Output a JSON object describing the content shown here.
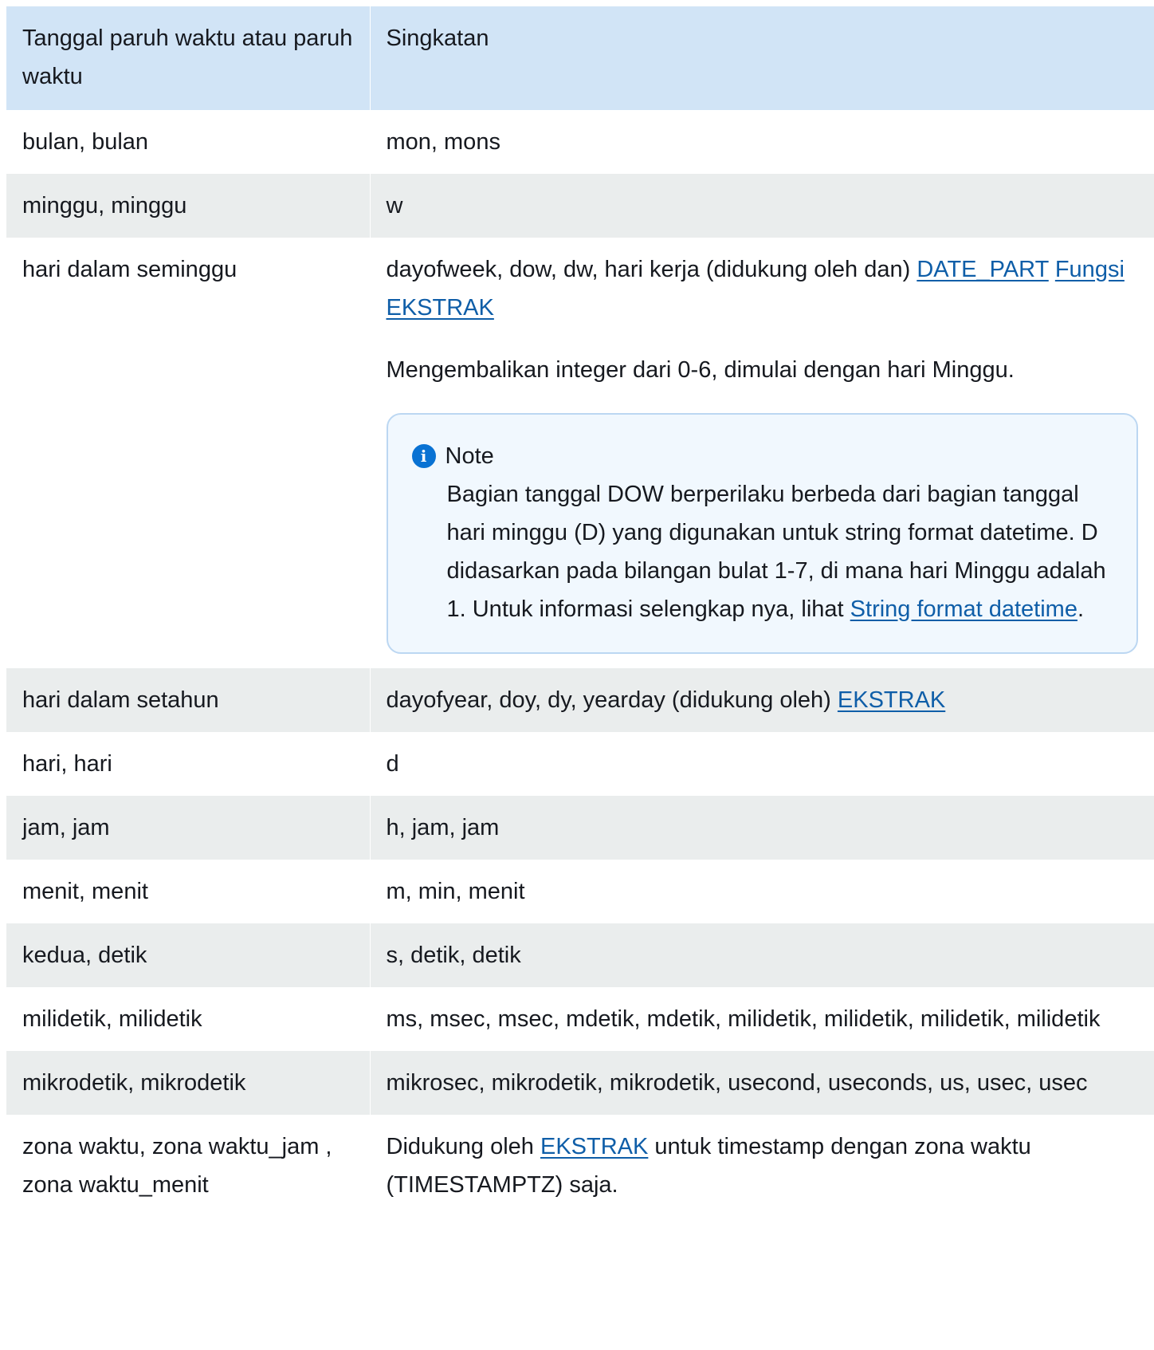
{
  "table": {
    "headers": [
      "Tanggal paruh waktu atau paruh waktu",
      "Singkatan"
    ],
    "rows": [
      {
        "part": "bulan, bulan",
        "abbr": "mon, mons"
      },
      {
        "part": "minggu, minggu",
        "abbr": "w"
      },
      {
        "part": "hari dalam seminggu",
        "abbr_text": "dayofweek, dow, dw, hari kerja (didukung oleh dan)",
        "link1": "DATE_PART",
        "link2": "Fungsi EKSTRAK",
        "extra": "Mengembalikan integer dari 0-6, dimulai dengan hari Minggu.",
        "note": {
          "title": "Note",
          "icon": "info-icon",
          "text": "Bagian tanggal DOW berperilaku berbeda dari bagian tanggal hari minggu (D) yang digunakan untuk string format datetime. D didasarkan pada bilangan bulat 1-7, di mana hari Minggu adalah 1. Untuk informasi selengkap nya, lihat",
          "link": "String format datetime",
          "after": "."
        }
      },
      {
        "part": "hari dalam setahun",
        "abbr_text": "dayofyear, doy, dy, yearday (didukung oleh)",
        "link": "EKSTRAK"
      },
      {
        "part": "hari, hari",
        "abbr": "d"
      },
      {
        "part": "jam, jam",
        "abbr": "h, jam, jam"
      },
      {
        "part": "menit, menit",
        "abbr": "m, min, menit"
      },
      {
        "part": "kedua, detik",
        "abbr": "s, detik, detik"
      },
      {
        "part": "milidetik, milidetik",
        "abbr": "ms, msec, msec, mdetik, mdetik, milidetik, milidetik, milidetik, milidetik"
      },
      {
        "part": "mikrodetik, mikrodetik",
        "abbr": "mikrosec, mikrodetik, mikrodetik, usecond, useconds, us, usec, usec"
      },
      {
        "part": "zona waktu, zona waktu_jam , zona waktu_menit",
        "abbr_before": "Didukung oleh",
        "link": "EKSTRAK",
        "abbr_after": "untuk timestamp dengan zona waktu (TIMESTAMPTZ) saja."
      }
    ]
  },
  "colors": {
    "header_bg": "#d1e4f6",
    "stripe_bg": "#eaeded",
    "link": "#0f5ea8",
    "note_border": "#bcd7f2",
    "note_bg": "#f1f8fe",
    "info_icon": "#0972d3"
  }
}
